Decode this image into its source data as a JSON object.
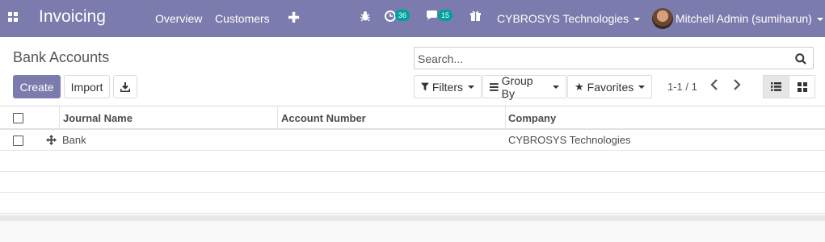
{
  "navbar": {
    "app_name": "Invoicing",
    "menu": [
      "Overview",
      "Customers"
    ],
    "activity_count": "36",
    "message_count": "15",
    "company": "CYBROSYS Technologies",
    "user": "Mitchell Admin (sumiharun)",
    "color": "#7c7bad"
  },
  "control": {
    "breadcrumb": "Bank Accounts",
    "create_label": "Create",
    "import_label": "Import",
    "search_placeholder": "Search...",
    "filters_label": "Filters",
    "groupby_label": "Group By",
    "favorites_label": "Favorites",
    "pager": "1-1 / 1"
  },
  "table": {
    "columns": [
      "Journal Name",
      "Account Number",
      "Company"
    ],
    "rows": [
      {
        "journal_name": "Bank",
        "account_number": "",
        "company": "CYBROSYS Technologies"
      }
    ]
  }
}
